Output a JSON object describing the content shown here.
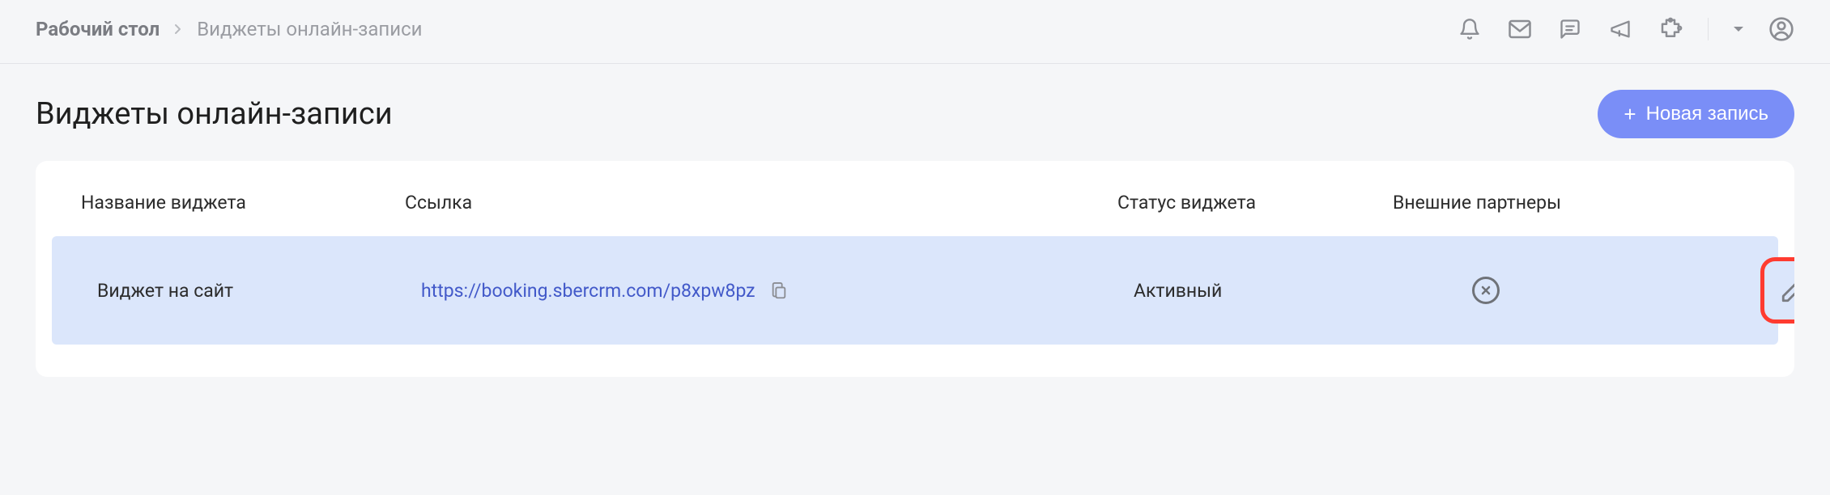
{
  "breadcrumb": {
    "root": "Рабочий стол",
    "current": "Виджеты онлайн-записи"
  },
  "page": {
    "title": "Виджеты онлайн-записи"
  },
  "actions": {
    "new_record": "Новая запись"
  },
  "table": {
    "headers": {
      "name": "Название виджета",
      "link": "Ссылка",
      "status": "Статус виджета",
      "partners": "Внешние партнеры"
    },
    "rows": [
      {
        "name": "Виджет на сайт",
        "link": "https://booking.sbercrm.com/p8xpw8pz",
        "status": "Активный"
      }
    ]
  },
  "icons": {
    "bell": "bell-icon",
    "mail": "mail-icon",
    "chat": "chat-icon",
    "megaphone": "megaphone-icon",
    "puzzle": "puzzle-icon",
    "user": "user-icon",
    "copy": "copy-icon",
    "pencil": "pencil-icon",
    "partner_badge": "x-circle-icon"
  }
}
